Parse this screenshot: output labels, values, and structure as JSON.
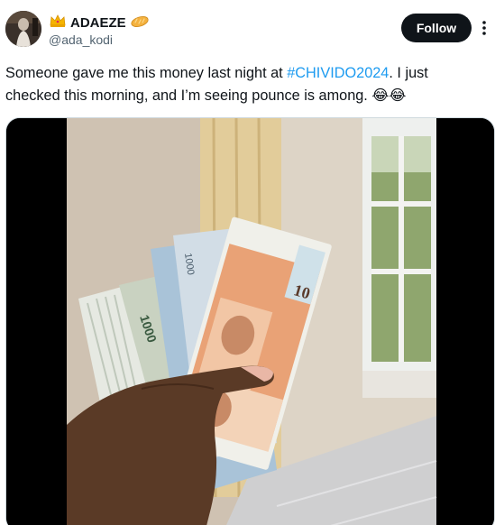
{
  "user": {
    "display_name": "ADAEZE",
    "handle": "@ada_kodi",
    "crown_emoji": "crown-icon",
    "bread_emoji": "bread-icon"
  },
  "actions": {
    "follow_label": "Follow"
  },
  "tweet": {
    "text_before": "Someone gave me this money last night at  ",
    "hashtag": "#CHIVIDO2024",
    "text_after": ". I just checked this morning, and I’m seeing pounce is among. ",
    "emoji": "😂😂"
  },
  "media": {
    "description_icon": "photo-of-money-in-hand"
  },
  "colors": {
    "accent": "#1d9bf0",
    "text": "#0f1419",
    "secondary": "#536471",
    "button": "#0f1419"
  }
}
